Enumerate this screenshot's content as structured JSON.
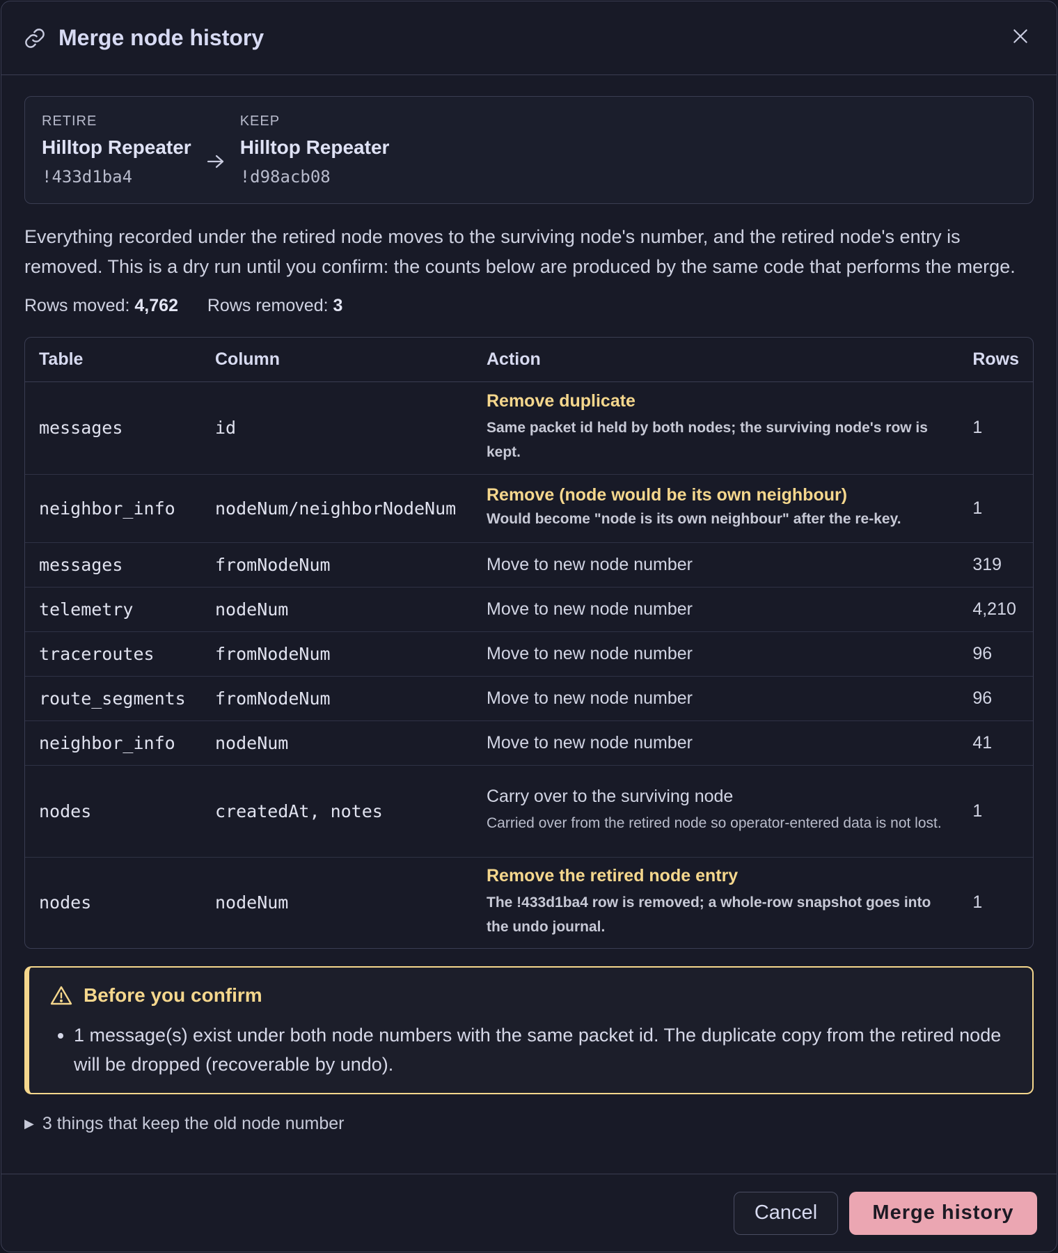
{
  "dialog": {
    "title": "Merge node history",
    "close_label": "Close"
  },
  "pair": {
    "retire_label": "RETIRE",
    "retire_name": "Hilltop Repeater",
    "retire_num": "!433d1ba4",
    "keep_label": "KEEP",
    "keep_name": "Hilltop Repeater",
    "keep_num": "!d98acb08"
  },
  "description": "Everything recorded under the retired node moves to the surviving node's number, and the retired node's entry is removed. This is a dry run until you confirm: the counts below are produced by the same code that performs the merge.",
  "counts": {
    "moved_label": "Rows moved:",
    "moved_value": "4,762",
    "removed_label": "Rows removed:",
    "removed_value": "3"
  },
  "table": {
    "headers": {
      "table": "Table",
      "column": "Column",
      "action": "Action",
      "rows": "Rows"
    },
    "rows": [
      {
        "table": "messages",
        "column": "id",
        "action": "Remove duplicate",
        "note": "Same packet id held by both nodes; the surviving node's row is kept.",
        "rows": "1"
      },
      {
        "table": "neighbor_info",
        "column": "nodeNum/neighborNodeNum",
        "action": "Remove (node would be its own neighbour)",
        "note": "Would become \"node is its own neighbour\" after the re-key.",
        "rows": "1"
      },
      {
        "table": "messages",
        "column": "fromNodeNum",
        "action": "Move to new node number",
        "rows": "319"
      },
      {
        "table": "telemetry",
        "column": "nodeNum",
        "action": "Move to new node number",
        "rows": "4,210"
      },
      {
        "table": "traceroutes",
        "column": "fromNodeNum",
        "action": "Move to new node number",
        "rows": "96"
      },
      {
        "table": "route_segments",
        "column": "fromNodeNum",
        "action": "Move to new node number",
        "rows": "96"
      },
      {
        "table": "neighbor_info",
        "column": "nodeNum",
        "action": "Move to new node number",
        "rows": "41"
      },
      {
        "table": "nodes",
        "column": "createdAt, notes",
        "action": "Carry over to the surviving node",
        "note": "Carried over from the retired node so operator-entered data is not lost.",
        "rows": "1"
      },
      {
        "table": "nodes",
        "column": "nodeNum",
        "action": "Remove the retired node entry",
        "note": "The !433d1ba4 row is removed; a whole-row snapshot goes into the undo journal.",
        "rows": "1"
      }
    ]
  },
  "warning": {
    "title": "Before you confirm",
    "items": [
      "1 message(s) exist under both node numbers with the same packet id. The duplicate copy from the retired node will be dropped (recoverable by undo)."
    ]
  },
  "details_label": "3 things that keep the old node number",
  "footer": {
    "cancel_label": "Cancel",
    "confirm_label": "Merge history"
  },
  "colors": {
    "background": "#181a27",
    "warning": "#f5d78d",
    "primary": "#eba6b2",
    "border": "#3a3d52"
  },
  "icons": {
    "title": "link-icon",
    "close": "close-icon",
    "arrow": "arrow-right-icon",
    "warning": "warning-triangle-icon",
    "details": "triangle-right-icon"
  }
}
